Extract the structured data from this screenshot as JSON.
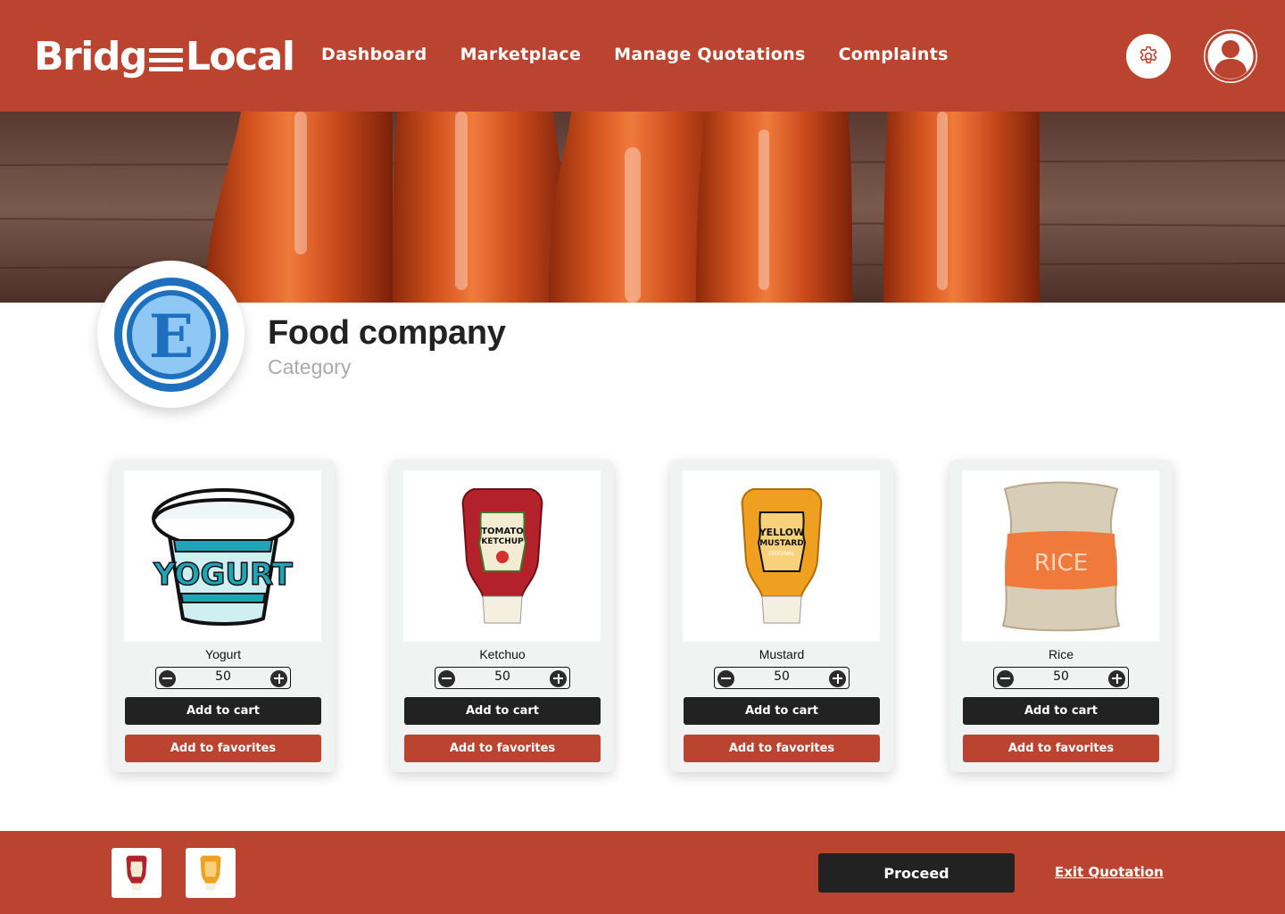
{
  "header": {
    "logo_left": "Bridg",
    "logo_right": "Local",
    "nav": [
      "Dashboard",
      "Marketplace",
      "Manage Quotations",
      "Complaints"
    ],
    "settings_icon": "gear-icon",
    "avatar_icon": "user-icon"
  },
  "company": {
    "name": "Food company",
    "category": "Category",
    "logo_letter": "E"
  },
  "products": [
    {
      "name": "Yogurt",
      "qty": "50",
      "cart_label": "Add to cart",
      "fav_label": "Add to favorites",
      "image_text": "YOGURT"
    },
    {
      "name": "Ketchuo",
      "qty": "50",
      "cart_label": "Add to cart",
      "fav_label": "Add to favorites",
      "image_text_1": "TOMATO",
      "image_text_2": "KETCHUP"
    },
    {
      "name": "Mustard",
      "qty": "50",
      "cart_label": "Add to cart",
      "fav_label": "Add to favorites",
      "image_text_1": "YELLOW",
      "image_text_2": "MUSTARD",
      "image_text_3": "ORIGINAL"
    },
    {
      "name": "Rice",
      "qty": "50",
      "cart_label": "Add to cart",
      "fav_label": "Add to favorites",
      "image_text": "RICE"
    }
  ],
  "footer": {
    "proceed_label": "Proceed",
    "exit_label": "Exit Quotation"
  },
  "colors": {
    "brand": "#bb4430",
    "dark": "#222222",
    "card_bg": "#f1f2f2",
    "logo_blue": "#1f6fbf"
  }
}
